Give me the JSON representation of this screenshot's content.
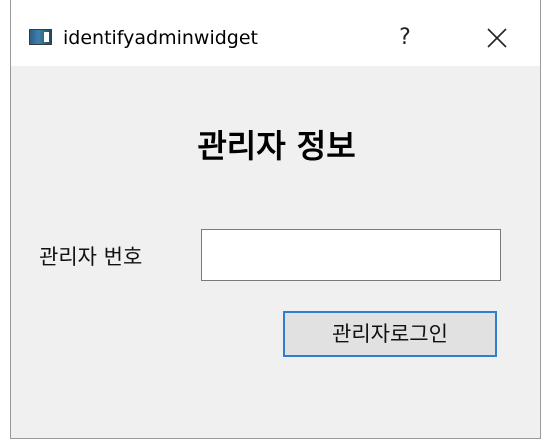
{
  "window": {
    "title": "identifyadminwidget",
    "help_label": "?",
    "app_icon": "app-window-icon",
    "close_icon": "close-icon"
  },
  "form": {
    "heading": "관리자 정보",
    "admin_number_label": "관리자 번호",
    "admin_number_value": "",
    "admin_number_placeholder": "",
    "login_button_label": "관리자로그인"
  },
  "colors": {
    "window_bg": "#f0f0f0",
    "titlebar_bg": "#ffffff",
    "button_focus_border": "#2f7fd0",
    "button_bg": "#e1e1e1"
  }
}
